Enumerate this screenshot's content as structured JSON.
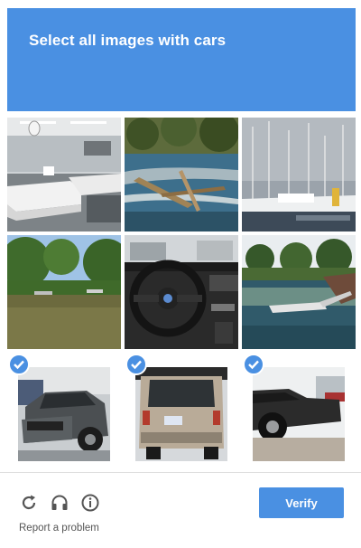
{
  "header": {
    "prompt": "Select all images with ",
    "keyword": "cars"
  },
  "tiles": [
    {
      "subject": "mattress showroom",
      "selected": false
    },
    {
      "subject": "driftwood in stream",
      "selected": false
    },
    {
      "subject": "sailboats in marina",
      "selected": false
    },
    {
      "subject": "river with trees",
      "selected": false
    },
    {
      "subject": "car steering wheel interior",
      "selected": false
    },
    {
      "subject": "lake with dock",
      "selected": false
    },
    {
      "subject": "gray sedan",
      "selected": true
    },
    {
      "subject": "minivan rear",
      "selected": true
    },
    {
      "subject": "classic car",
      "selected": true
    }
  ],
  "footer": {
    "verify_label": "Verify",
    "report_label": "Report a problem",
    "icons": [
      "reload-icon",
      "audio-icon",
      "info-icon"
    ]
  },
  "colors": {
    "accent": "#4a90e2"
  }
}
